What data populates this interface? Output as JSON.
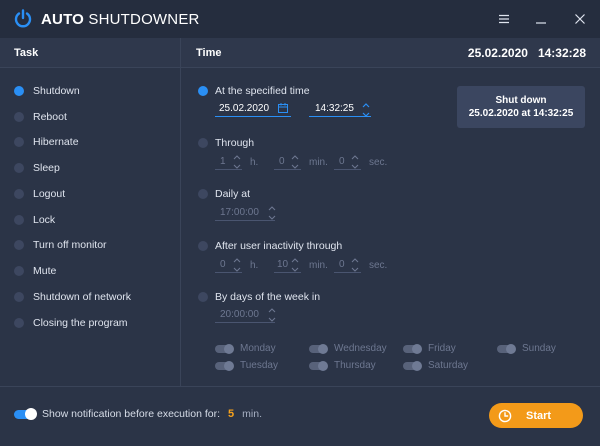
{
  "app": {
    "title_bold": "AUTO",
    "title_rest": " SHUTDOWNER"
  },
  "header": {
    "task": "Task",
    "time": "Time",
    "date": "25.02.2020",
    "clock": "14:32:28"
  },
  "tasks": [
    {
      "label": "Shutdown",
      "selected": true
    },
    {
      "label": "Reboot",
      "selected": false
    },
    {
      "label": "Hibernate",
      "selected": false
    },
    {
      "label": "Sleep",
      "selected": false
    },
    {
      "label": "Logout",
      "selected": false
    },
    {
      "label": "Lock",
      "selected": false
    },
    {
      "label": "Turn off monitor",
      "selected": false
    },
    {
      "label": "Mute",
      "selected": false
    },
    {
      "label": "Shutdown of network",
      "selected": false
    },
    {
      "label": "Closing the program",
      "selected": false
    }
  ],
  "options": {
    "specified": {
      "label": "At the specified time",
      "date": "25.02.2020",
      "time": "14:32:25"
    },
    "through": {
      "label": "Through",
      "h": "1",
      "min": "0",
      "sec": "0",
      "u_h": "h.",
      "u_min": "min.",
      "u_sec": "sec."
    },
    "daily": {
      "label": "Daily at",
      "time": "17:00:00"
    },
    "inactivity": {
      "label": "After user inactivity through",
      "h": "0",
      "min": "10",
      "sec": "0",
      "u_h": "h.",
      "u_min": "min.",
      "u_sec": "sec."
    },
    "weekly": {
      "label": "By days of the week in",
      "time": "20:00:00",
      "days": [
        "Monday",
        "Wednesday",
        "Friday",
        "Sunday",
        "Tuesday",
        "Thursday",
        "Saturday"
      ]
    }
  },
  "shutdown_box": {
    "line1": "Shut down",
    "line2": "25.02.2020 at 14:32:25"
  },
  "footer": {
    "notif_label": "Show notification before execution for:",
    "notif_value": "5",
    "notif_unit": "min.",
    "start": "Start"
  },
  "colors": {
    "accent": "#2a8ff5",
    "start": "#f39a19",
    "bg": "#2b3447"
  }
}
